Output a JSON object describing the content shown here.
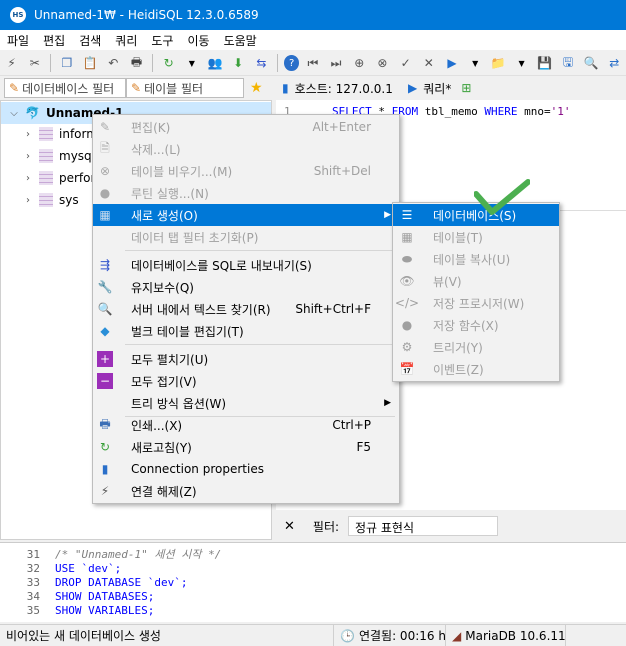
{
  "window": {
    "title": "Unnamed-1₩ - HeidiSQL 12.3.0.6589",
    "app_icon_text": "HS"
  },
  "menubar": [
    "파일",
    "편집",
    "검색",
    "쿼리",
    "도구",
    "이동",
    "도움말"
  ],
  "filters": {
    "database_filter": "데이터베이스 필터",
    "table_filter": "테이블 필터"
  },
  "tabs": {
    "host": "호스트: 127.0.0.1",
    "query": "쿼리*"
  },
  "tree": {
    "root": "Unnamed-1",
    "items": [
      "inform",
      "mysql",
      "perfor",
      "sys"
    ]
  },
  "editor": {
    "line_number": "1",
    "sql": {
      "kw1": "SELECT",
      "star": " * ",
      "kw2": "FROM",
      "table": " tbl_memo ",
      "kw3": "WHERE",
      "cond": " mno=",
      "value": "'1'"
    }
  },
  "context_menu": [
    {
      "label": "편집(K)",
      "shortcut": "Alt+Enter",
      "disabled": true,
      "icon": "edit-icon"
    },
    {
      "label": "삭제...(L)",
      "shortcut": "",
      "disabled": true,
      "icon": "delete-icon"
    },
    {
      "label": "테이블 비우기...(M)",
      "shortcut": "Shift+Del",
      "disabled": true,
      "icon": "truncate-icon"
    },
    {
      "label": "루틴 실행...(N)",
      "shortcut": "",
      "disabled": true,
      "icon": "run-routine-icon"
    },
    {
      "label": "새로 생성(O)",
      "shortcut": "",
      "disabled": false,
      "icon": "create-new-icon",
      "submenu": true
    },
    {
      "label": "데이터 탭 필터 초기화(P)",
      "shortcut": "",
      "disabled": true,
      "icon": ""
    },
    {
      "label": "데이터베이스를 SQL로 내보내기(S)",
      "shortcut": "",
      "disabled": false,
      "icon": "export-icon"
    },
    {
      "label": "유지보수(Q)",
      "shortcut": "",
      "disabled": false,
      "icon": "wrench-icon"
    },
    {
      "label": "서버 내에서 텍스트 찾기(R)",
      "shortcut": "Shift+Ctrl+F",
      "disabled": false,
      "icon": "search-icon"
    },
    {
      "label": "벌크 테이블 편집기(T)",
      "shortcut": "",
      "disabled": false,
      "icon": "bulk-edit-icon"
    },
    {
      "label": "모두 펼치기(U)",
      "shortcut": "",
      "disabled": false,
      "icon": "expand-icon"
    },
    {
      "label": "모두 접기(V)",
      "shortcut": "",
      "disabled": false,
      "icon": "collapse-icon"
    },
    {
      "label": "트리 방식 옵션(W)",
      "shortcut": "",
      "disabled": false,
      "icon": "",
      "submenu": true
    },
    {
      "label": "인쇄...(X)",
      "shortcut": "Ctrl+P",
      "disabled": false,
      "icon": "print-icon"
    },
    {
      "label": "새로고침(Y)",
      "shortcut": "F5",
      "disabled": false,
      "icon": "refresh-icon"
    },
    {
      "label": "Connection properties",
      "shortcut": "",
      "disabled": false,
      "icon": "connection-icon"
    },
    {
      "label": "연결 해제(Z)",
      "shortcut": "",
      "disabled": false,
      "icon": "disconnect-icon"
    }
  ],
  "submenu": [
    {
      "label": "데이터베이스(S)",
      "disabled": false,
      "icon": "database-icon"
    },
    {
      "label": "테이블(T)",
      "disabled": true,
      "icon": "table-icon"
    },
    {
      "label": "테이블 복사(U)",
      "disabled": true,
      "icon": "table-copy-icon"
    },
    {
      "label": "뷰(V)",
      "disabled": true,
      "icon": "view-icon"
    },
    {
      "label": "저장 프로시저(W)",
      "disabled": true,
      "icon": "procedure-icon"
    },
    {
      "label": "저장 함수(X)",
      "disabled": true,
      "icon": "function-icon"
    },
    {
      "label": "트리거(Y)",
      "disabled": true,
      "icon": "trigger-icon"
    },
    {
      "label": "이벤트(Z)",
      "disabled": true,
      "icon": "event-icon"
    }
  ],
  "bottom_filter": {
    "label": "필터:",
    "placeholder": "정규 표현식"
  },
  "log": [
    {
      "num": "31",
      "text": "/* \"Unnamed-1\" 세션 시작 */"
    },
    {
      "num": "32",
      "text": "USE `dev`;"
    },
    {
      "num": "33",
      "text": "DROP DATABASE `dev`;"
    },
    {
      "num": "34",
      "text": "SHOW DATABASES;"
    },
    {
      "num": "35",
      "text": "SHOW VARIABLES;"
    }
  ],
  "status": {
    "message": "비어있는 새 데이터베이스 생성",
    "connected": "연결됨: 00:16 h",
    "server": "MariaDB 10.6.11"
  },
  "colors": {
    "accent": "#0078d7",
    "keyword": "#0000ff",
    "string": "#800080",
    "checkmark": "#4caf50"
  }
}
